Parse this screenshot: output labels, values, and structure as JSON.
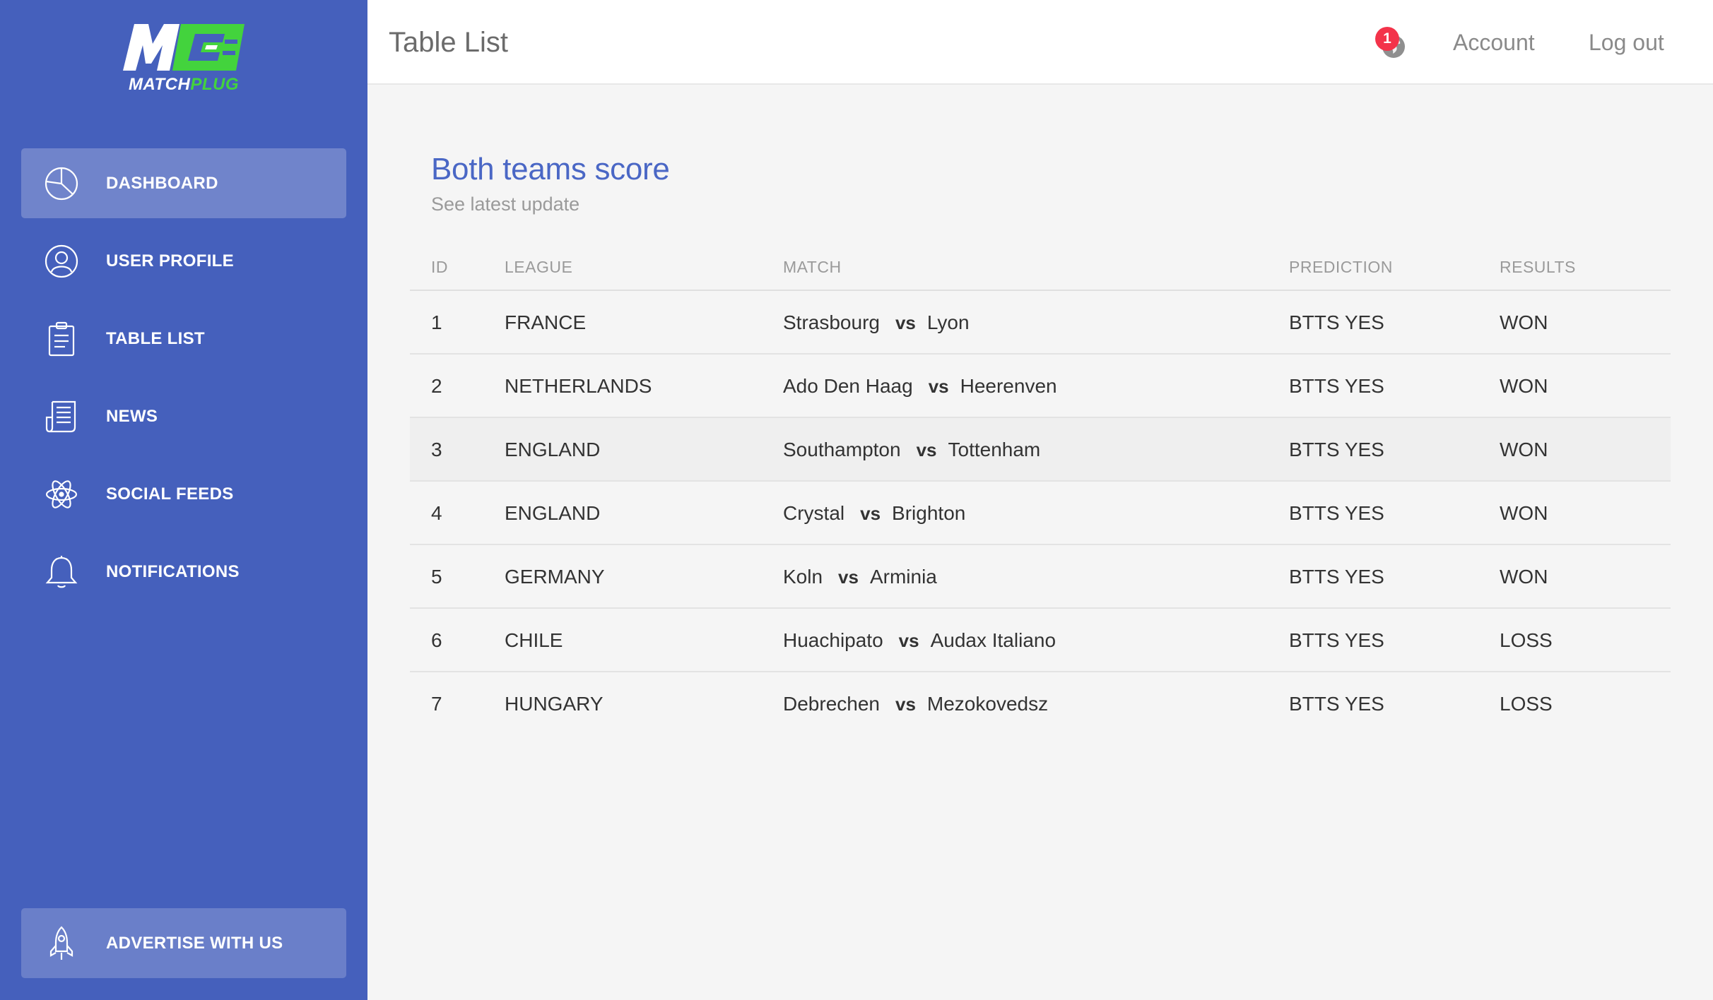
{
  "brand": {
    "word_part1": "MATCH",
    "word_part2": "PLUG",
    "primary_color": "#4560bc",
    "accent_color": "#43d33d"
  },
  "sidebar": {
    "items": [
      {
        "label": "DASHBOARD",
        "icon": "dashboard-pie-icon",
        "active": true
      },
      {
        "label": "USER PROFILE",
        "icon": "user-icon",
        "active": false
      },
      {
        "label": "TABLE LIST",
        "icon": "clipboard-icon",
        "active": false
      },
      {
        "label": "NEWS",
        "icon": "newspaper-icon",
        "active": false
      },
      {
        "label": "SOCIAL FEEDS",
        "icon": "atom-icon",
        "active": false
      },
      {
        "label": "NOTIFICATIONS",
        "icon": "bell-icon",
        "active": false
      }
    ],
    "advertise_label": "ADVERTISE WITH US",
    "advertise_icon": "rocket-icon"
  },
  "header": {
    "title": "Table List",
    "notification_count": "1",
    "account_label": "Account",
    "logout_label": "Log out",
    "badge_color": "#f3334a"
  },
  "card": {
    "title": "Both teams score",
    "subtitle": "See latest update"
  },
  "table": {
    "columns": [
      "ID",
      "LEAGUE",
      "MATCH",
      "PREDICTION",
      "RESULTS"
    ],
    "vs_label": "vs",
    "rows": [
      {
        "id": "1",
        "league": "FRANCE",
        "home": "Strasbourg",
        "away": "Lyon",
        "prediction": "BTTS YES",
        "result": "WON"
      },
      {
        "id": "2",
        "league": "NETHERLANDS",
        "home": "Ado Den Haag",
        "away": "Heerenven",
        "prediction": "BTTS YES",
        "result": "WON"
      },
      {
        "id": "3",
        "league": "ENGLAND",
        "home": "Southampton",
        "away": "Tottenham",
        "prediction": "BTTS YES",
        "result": "WON"
      },
      {
        "id": "4",
        "league": "ENGLAND",
        "home": "Crystal",
        "away": "Brighton",
        "prediction": "BTTS YES",
        "result": "WON"
      },
      {
        "id": "5",
        "league": "GERMANY",
        "home": "Koln",
        "away": "Arminia",
        "prediction": "BTTS YES",
        "result": "WON"
      },
      {
        "id": "6",
        "league": "CHILE",
        "home": "Huachipato",
        "away": "Audax Italiano",
        "prediction": "BTTS YES",
        "result": "LOSS"
      },
      {
        "id": "7",
        "league": "HUNGARY",
        "home": "Debrechen",
        "away": "Mezokovedsz",
        "prediction": "BTTS YES",
        "result": "LOSS"
      }
    ]
  }
}
